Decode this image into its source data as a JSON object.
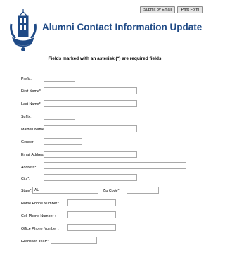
{
  "toolbar": {
    "email_label": "Submit by Email",
    "print_label": "Print Form"
  },
  "logo": {
    "primary_color": "#1f4a86"
  },
  "page": {
    "title": "Alumni Contact Information Update",
    "required_note": "Fields marked with an asterisk (*) are required fields"
  },
  "form": {
    "prefix": {
      "label": "Prefix:",
      "value": ""
    },
    "first_name": {
      "label": "First Name*:",
      "value": ""
    },
    "last_name": {
      "label": "Last Name*:",
      "value": ""
    },
    "suffix": {
      "label": "Suffix:",
      "value": ""
    },
    "maiden_name": {
      "label": "Maiden Name:",
      "value": ""
    },
    "gender": {
      "label": "Gender",
      "value": ""
    },
    "email": {
      "label": "Email Address:",
      "value": ""
    },
    "address": {
      "label": "Address*:",
      "value": ""
    },
    "city": {
      "label": "City*:",
      "value": ""
    },
    "state": {
      "label": "State*:",
      "value": "AL"
    },
    "zip": {
      "label": "Zip Code*:",
      "value": ""
    },
    "home_phone": {
      "label": "Home Phone Number :",
      "value": ""
    },
    "cell_phone": {
      "label": "Cell Phone Number :",
      "value": ""
    },
    "office_phone": {
      "label": "Office Phone Number :",
      "value": ""
    },
    "grad_year": {
      "label": "Gradation Year*:",
      "value": ""
    }
  }
}
